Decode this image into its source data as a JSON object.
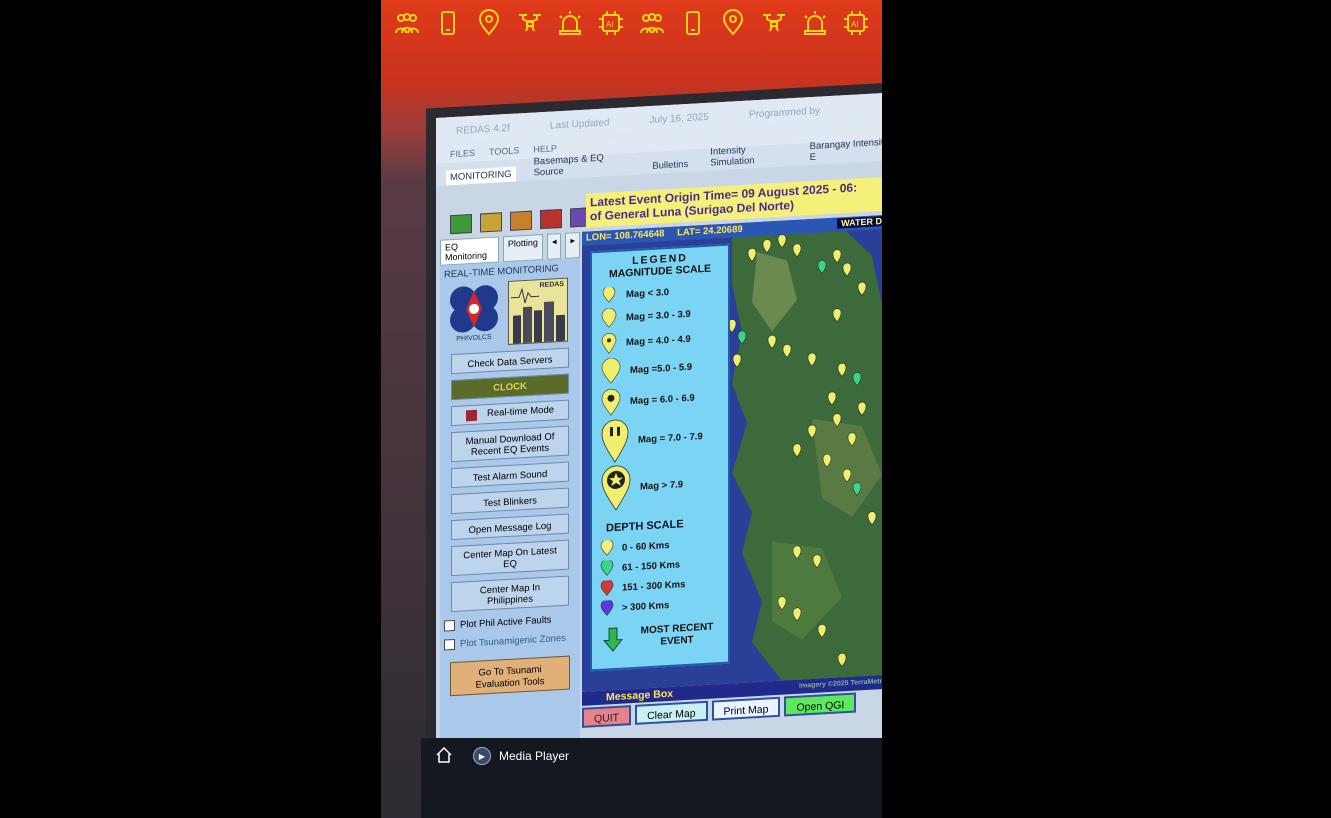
{
  "app": {
    "title_fragments": [
      "REDAS 4.2f",
      "Last Updated",
      "July 16, 2025",
      "Programmed by"
    ],
    "menu": [
      "FILES",
      "TOOLS",
      "HELP"
    ],
    "tabs": [
      "MONITORING",
      "Basemaps & EQ Source",
      "Bulletins",
      "Intensity Simulation",
      "Barangay Intensity E"
    ],
    "latest_event": {
      "line1": "Latest Event  Origin Time= 09 August 2025 - 06:",
      "line2": "of General Luna (Surigao Del Norte)"
    },
    "swatch_colors": [
      "#3f9a3a",
      "#c9a23a",
      "#c8802a",
      "#b8322e",
      "#6a4ab0"
    ]
  },
  "left_panel": {
    "subtabs": [
      "EQ Monitoring",
      "Plotting"
    ],
    "title": "REAL-TIME MONITORING",
    "phivolcs_label": "PHIVOLCS",
    "redas_label": "REDAS",
    "buttons": {
      "check_servers": "Check Data Servers",
      "clock": "CLOCK",
      "realtime": "Real-time Mode",
      "manual_download": "Manual Download Of Recent EQ Events",
      "test_alarm": "Test Alarm Sound",
      "test_blinkers": "Test Blinkers",
      "open_log": "Open Message Log",
      "center_latest": "Center Map On Latest EQ",
      "center_ph": "Center Map In Philippines"
    },
    "checkbox_faults": "Plot Phil  Active Faults",
    "checkbox_tsunami": "Plot Tsunamigenic Zones",
    "tsunami_button": "Go To Tsunami Evaluation Tools"
  },
  "map": {
    "lon": "LON= 108.764648",
    "lat": "LAT= 24.20689",
    "water_depth": "WATER DEP",
    "message_box": "Message Box",
    "credit": "Imagery ©2025 TerraMetrics"
  },
  "legend": {
    "title": "LEGEND",
    "mag_title": "MAGNITUDE SCALE",
    "mags": [
      "Mag < 3.0",
      "Mag = 3.0 - 3.9",
      "Mag = 4.0 - 4.9",
      "Mag =5.0 - 5.9",
      "Mag = 6.0 - 6.9",
      "Mag = 7.0 - 7.9",
      "Mag > 7.9"
    ],
    "depth_title": "DEPTH SCALE",
    "depths": [
      "0 - 60 Kms",
      "61 - 150 Kms",
      "151 - 300 Kms",
      "> 300 Kms"
    ],
    "depth_colors": [
      "#f2f07a",
      "#3cd48a",
      "#d23a3a",
      "#5a3ad8"
    ],
    "most_recent": "MOST RECENT EVENT"
  },
  "bottom_buttons": [
    "QUIT",
    "Clear Map",
    "Print Map",
    "Open QGI"
  ],
  "taskbar": {
    "media_player": "Media Player"
  }
}
